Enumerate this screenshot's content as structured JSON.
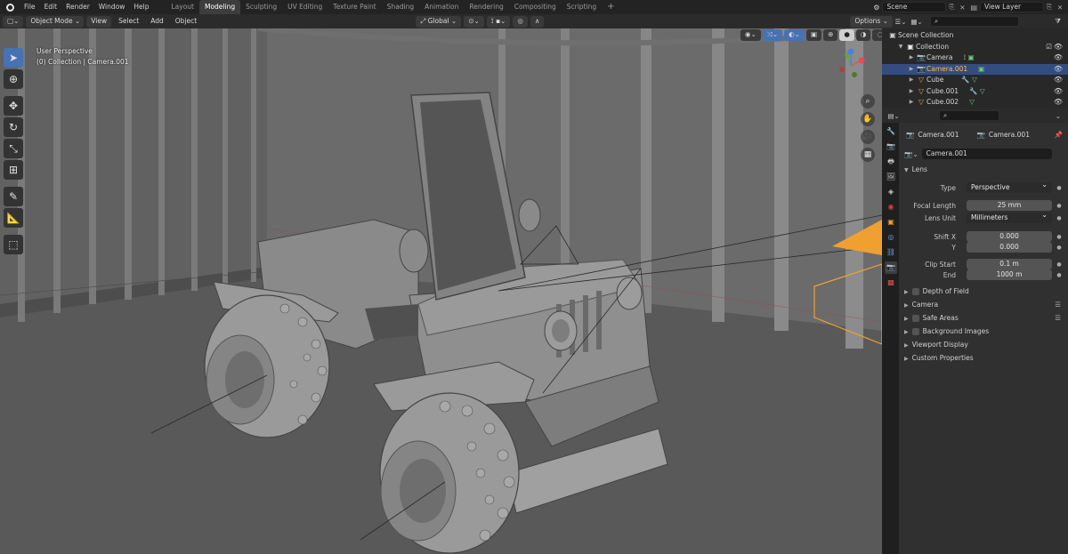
{
  "menus": [
    "File",
    "Edit",
    "Render",
    "Window",
    "Help"
  ],
  "workspace_tabs": [
    {
      "label": "Layout",
      "active": false
    },
    {
      "label": "Modeling",
      "active": true
    },
    {
      "label": "Sculpting",
      "active": false
    },
    {
      "label": "UV Editing",
      "active": false
    },
    {
      "label": "Texture Paint",
      "active": false
    },
    {
      "label": "Shading",
      "active": false
    },
    {
      "label": "Animation",
      "active": false
    },
    {
      "label": "Rendering",
      "active": false
    },
    {
      "label": "Compositing",
      "active": false
    },
    {
      "label": "Scripting",
      "active": false
    }
  ],
  "scene": "Scene",
  "view_layer": "View Layer",
  "viewport_header": {
    "mode": "Object Mode",
    "menus": [
      "View",
      "Select",
      "Add",
      "Object"
    ],
    "orientation": "Global",
    "options": "Options"
  },
  "viewport_overlay": {
    "view_name": "User Perspective",
    "collection_info": "(0) Collection | Camera.001"
  },
  "outliner": {
    "root": "Scene Collection",
    "collection": "Collection",
    "items": [
      {
        "name": "Camera",
        "type": "camera",
        "selected": false
      },
      {
        "name": "Camera.001",
        "type": "camera",
        "selected": true
      },
      {
        "name": "Cube",
        "type": "mesh",
        "selected": false
      },
      {
        "name": "Cube.001",
        "type": "mesh",
        "selected": false
      },
      {
        "name": "Cube.002",
        "type": "mesh",
        "selected": false
      }
    ]
  },
  "properties": {
    "object_name": "Camera.001",
    "data_name": "Camera.001",
    "datablock": "Camera.001",
    "lens_panel": "Lens",
    "type_label": "Type",
    "type_value": "Perspective",
    "focal_label": "Focal Length",
    "focal_value": "25 mm",
    "lens_unit_label": "Lens Unit",
    "lens_unit_value": "Millimeters",
    "shift_x_label": "Shift X",
    "shift_x_value": "0.000",
    "shift_y_label": "Y",
    "shift_y_value": "0.000",
    "clip_start_label": "Clip Start",
    "clip_start_value": "0.1 m",
    "clip_end_label": "End",
    "clip_end_value": "1000 m",
    "panels": [
      "Depth of Field",
      "Camera",
      "Safe Areas",
      "Background Images",
      "Viewport Display",
      "Custom Properties"
    ]
  },
  "colors": {
    "accent": "#4772b3",
    "selection": "#334d80",
    "camera_orange": "#f0a030",
    "mesh_icon": "#e8a040"
  }
}
